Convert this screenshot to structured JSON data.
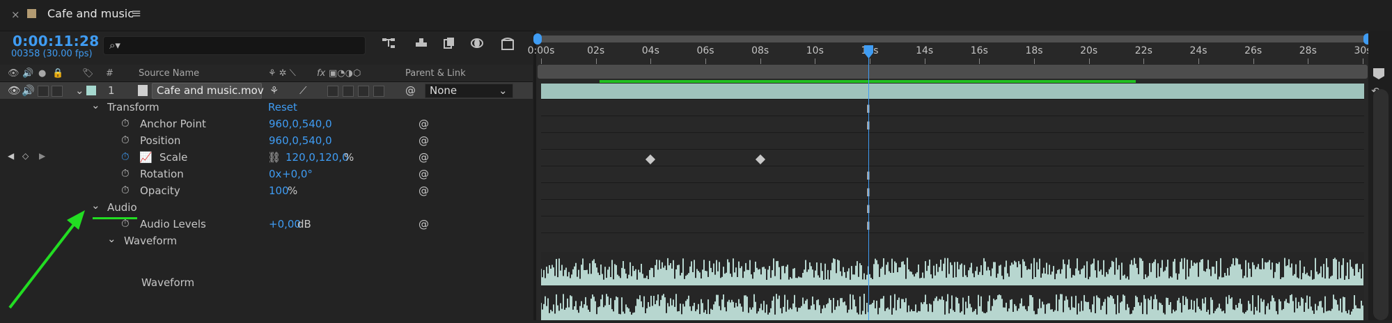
{
  "tab": {
    "close": "×",
    "title": "Cafe and music",
    "menu": "≡",
    "swatch_color": "#b39b72"
  },
  "toolbar": {
    "timecode": "0:00:11:28",
    "frames": "00358 (30.00 fps)",
    "search_placeholder": ""
  },
  "columns": {
    "number": "#",
    "source_name": "Source Name",
    "parent_link": "Parent & Link",
    "fx": "fx"
  },
  "layer": {
    "index": "1",
    "name": "Cafe and music.mov",
    "parent": "None",
    "label_color": "#a5d8cf"
  },
  "properties": {
    "transform": {
      "label": "Transform",
      "reset": "Reset"
    },
    "anchor_point": {
      "label": "Anchor Point",
      "value": "960,0,540,0"
    },
    "position": {
      "label": "Position",
      "value": "960,0,540,0"
    },
    "scale": {
      "label": "Scale",
      "value": "120,0,120,0",
      "unit": "%"
    },
    "rotation": {
      "label": "Rotation",
      "value_prefix": "0x",
      "value": "+0,0°"
    },
    "opacity": {
      "label": "Opacity",
      "value": "100",
      "unit": "%"
    },
    "audio": {
      "label": "Audio"
    },
    "audio_levels": {
      "label": "Audio Levels",
      "value": "+0,00",
      "unit": "dB"
    },
    "waveform_group": {
      "label": "Waveform"
    },
    "waveform": {
      "label": "Waveform"
    }
  },
  "timeline": {
    "ruler_labels": [
      "0:00s",
      "02s",
      "04s",
      "06s",
      "08s",
      "10s",
      "12s",
      "14s",
      "16s",
      "18s",
      "20s",
      "22s",
      "24s",
      "26s",
      "28s",
      "30s"
    ],
    "current_time_seconds": 12,
    "keyframe_times_seconds": [
      4,
      8
    ],
    "work_area_seconds": [
      2,
      22
    ],
    "colors": {
      "accent": "#3f9cf3",
      "layer_bar": "#9fc3bc",
      "work_area": "#20c020",
      "annotation": "#22dd22"
    }
  }
}
